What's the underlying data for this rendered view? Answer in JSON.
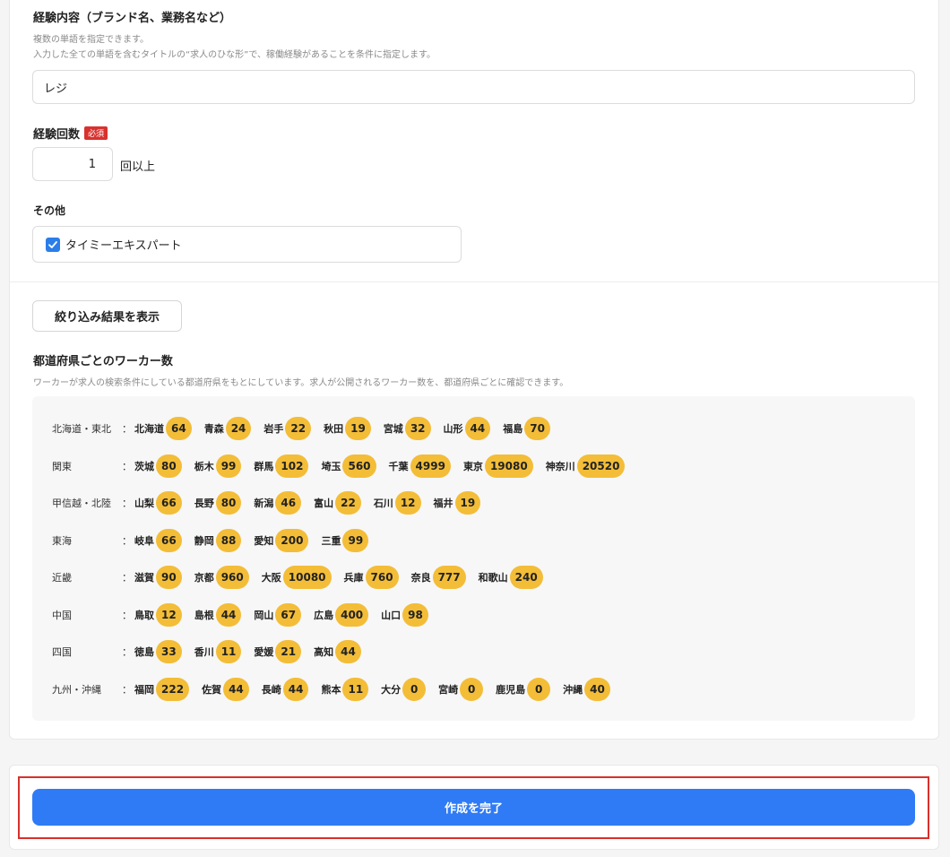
{
  "experience": {
    "label": "経験内容（ブランド名、業務名など）",
    "hint_1": "複数の単語を指定できます。",
    "hint_2": "入力した全ての単語を含むタイトルの“求人のひな形”で、稼働経験があることを条件に指定します。",
    "value": "レジ"
  },
  "count": {
    "label": "経験回数",
    "required_badge": "必須",
    "value": "1",
    "suffix": "回以上"
  },
  "other": {
    "label": "その他",
    "checkbox_label": "タイミーエキスパート",
    "checked": true
  },
  "filter_button": "絞り込み結果を表示",
  "workers": {
    "title": "都道府県ごとのワーカー数",
    "hint": "ワーカーが求人の検索条件にしている都道府県をもとにしています。求人が公開されるワーカー数を、都道府県ごとに確認できます。",
    "colon": "：",
    "regions": [
      {
        "name": "北海道・東北",
        "prefs": [
          {
            "name": "北海道",
            "count": "64"
          },
          {
            "name": "青森",
            "count": "24"
          },
          {
            "name": "岩手",
            "count": "22"
          },
          {
            "name": "秋田",
            "count": "19"
          },
          {
            "name": "宮城",
            "count": "32"
          },
          {
            "name": "山形",
            "count": "44"
          },
          {
            "name": "福島",
            "count": "70"
          }
        ]
      },
      {
        "name": "関東",
        "prefs": [
          {
            "name": "茨城",
            "count": "80"
          },
          {
            "name": "栃木",
            "count": "99"
          },
          {
            "name": "群馬",
            "count": "102"
          },
          {
            "name": "埼玉",
            "count": "560"
          },
          {
            "name": "千葉",
            "count": "4999"
          },
          {
            "name": "東京",
            "count": "19080"
          },
          {
            "name": "神奈川",
            "count": "20520"
          }
        ]
      },
      {
        "name": "甲信越・北陸",
        "prefs": [
          {
            "name": "山梨",
            "count": "66"
          },
          {
            "name": "長野",
            "count": "80"
          },
          {
            "name": "新潟",
            "count": "46"
          },
          {
            "name": "富山",
            "count": "22"
          },
          {
            "name": "石川",
            "count": "12"
          },
          {
            "name": "福井",
            "count": "19"
          }
        ]
      },
      {
        "name": "東海",
        "prefs": [
          {
            "name": "岐阜",
            "count": "66"
          },
          {
            "name": "静岡",
            "count": "88"
          },
          {
            "name": "愛知",
            "count": "200"
          },
          {
            "name": "三重",
            "count": "99"
          }
        ]
      },
      {
        "name": "近畿",
        "prefs": [
          {
            "name": "滋賀",
            "count": "90"
          },
          {
            "name": "京都",
            "count": "960"
          },
          {
            "name": "大阪",
            "count": "10080"
          },
          {
            "name": "兵庫",
            "count": "760"
          },
          {
            "name": "奈良",
            "count": "777"
          },
          {
            "name": "和歌山",
            "count": "240"
          }
        ]
      },
      {
        "name": "中国",
        "prefs": [
          {
            "name": "鳥取",
            "count": "12"
          },
          {
            "name": "島根",
            "count": "44"
          },
          {
            "name": "岡山",
            "count": "67"
          },
          {
            "name": "広島",
            "count": "400"
          },
          {
            "name": "山口",
            "count": "98"
          }
        ]
      },
      {
        "name": "四国",
        "prefs": [
          {
            "name": "徳島",
            "count": "33"
          },
          {
            "name": "香川",
            "count": "11"
          },
          {
            "name": "愛媛",
            "count": "21"
          },
          {
            "name": "高知",
            "count": "44"
          }
        ]
      },
      {
        "name": "九州・沖縄",
        "prefs": [
          {
            "name": "福岡",
            "count": "222"
          },
          {
            "name": "佐賀",
            "count": "44"
          },
          {
            "name": "長崎",
            "count": "44"
          },
          {
            "name": "熊本",
            "count": "11"
          },
          {
            "name": "大分",
            "count": "0"
          },
          {
            "name": "宮崎",
            "count": "0"
          },
          {
            "name": "鹿児島",
            "count": "0"
          },
          {
            "name": "沖縄",
            "count": "40"
          }
        ]
      }
    ]
  },
  "submit_button": "作成を完了",
  "colors": {
    "primary": "#2f7bf5",
    "pill": "#f3bd37",
    "required": "#d8322f",
    "highlight": "#d9302b"
  }
}
